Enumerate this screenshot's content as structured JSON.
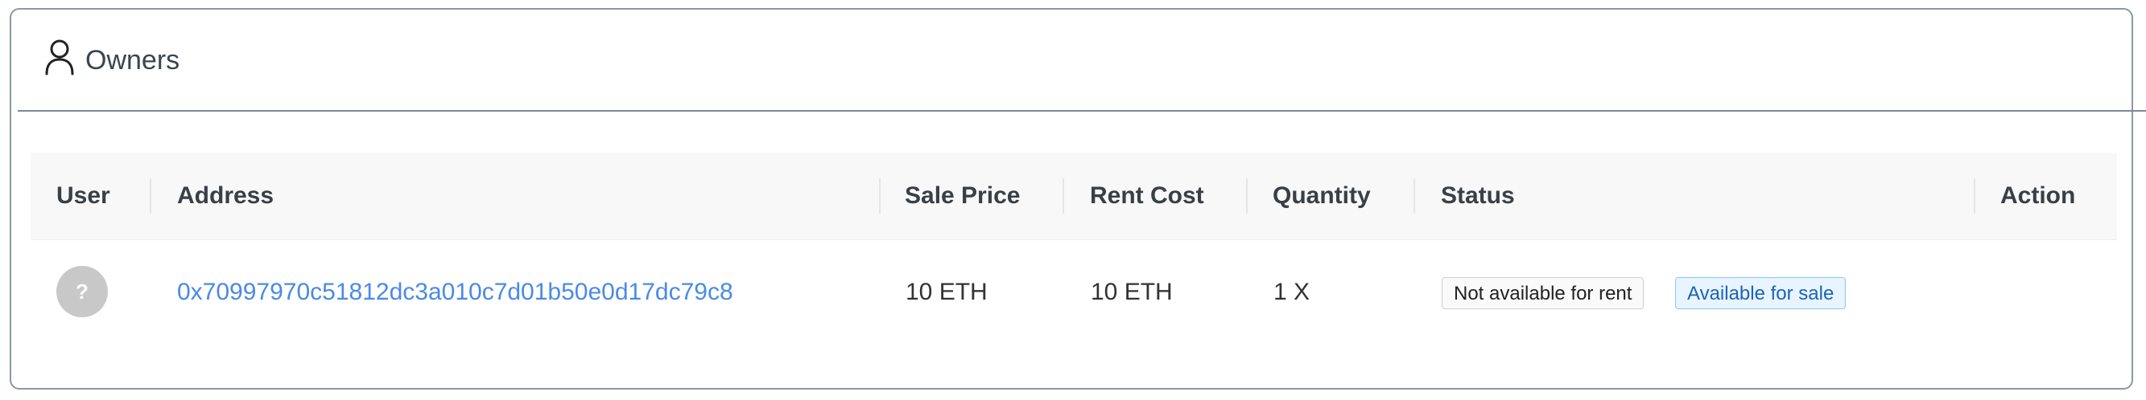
{
  "card": {
    "title": "Owners",
    "icon": "user-icon"
  },
  "table": {
    "columns": [
      "User",
      "Address",
      "Sale Price",
      "Rent Cost",
      "Quantity",
      "Status",
      "Action"
    ],
    "rows": [
      {
        "avatar": "?",
        "address": "0x70997970c51812dc3a010c7d01b50e0d17dc79c8",
        "sale_price": "10 ETH",
        "rent_cost": "10 ETH",
        "quantity": "1 X",
        "status_tags": [
          "Not available for rent",
          "Available for sale"
        ],
        "action": ""
      }
    ]
  },
  "colors": {
    "link": "#4a8ae6",
    "tag_blue_bg": "#e8f4ff",
    "tag_blue_border": "#8ec5f5",
    "border": "#8a98a6"
  }
}
